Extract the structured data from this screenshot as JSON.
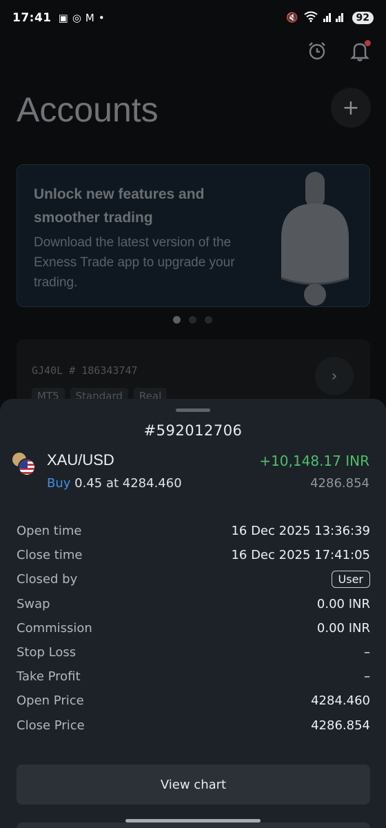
{
  "status_bar": {
    "time": "17:41",
    "battery": "92"
  },
  "header": {
    "title": "Accounts",
    "add_label": "+"
  },
  "promo": {
    "title": "Unlock new features and smoother trading",
    "body": "Download the latest version of the Exness Trade app to upgrade your trading."
  },
  "account_card": {
    "name": "GJ40L",
    "number": "# 186343747",
    "tags": [
      "MT5",
      "Standard",
      "Real"
    ]
  },
  "order_sheet": {
    "order_id": "#592012706",
    "symbol": "XAU/USD",
    "profit": "+10,148.17 INR",
    "side": "Buy",
    "volume_price": "0.45 at 4284.460",
    "current_price": "4286.854",
    "details": [
      {
        "label": "Open time",
        "value": "16 Dec 2025 13:36:39"
      },
      {
        "label": "Close time",
        "value": "16 Dec 2025 17:41:05"
      },
      {
        "label": "Closed by",
        "value": "User"
      },
      {
        "label": "Swap",
        "value": "0.00 INR"
      },
      {
        "label": "Commission",
        "value": "0.00 INR"
      },
      {
        "label": "Stop Loss",
        "value": "–"
      },
      {
        "label": "Take Profit",
        "value": "–"
      },
      {
        "label": "Open Price",
        "value": "4284.460"
      },
      {
        "label": "Close Price",
        "value": "4286.854"
      }
    ],
    "view_chart_label": "View chart"
  },
  "colors": {
    "profit": "#4fbf6a",
    "buy": "#3f8fe6",
    "sheet_bg": "#1c2228",
    "notification_dot": "#b23a3a"
  }
}
